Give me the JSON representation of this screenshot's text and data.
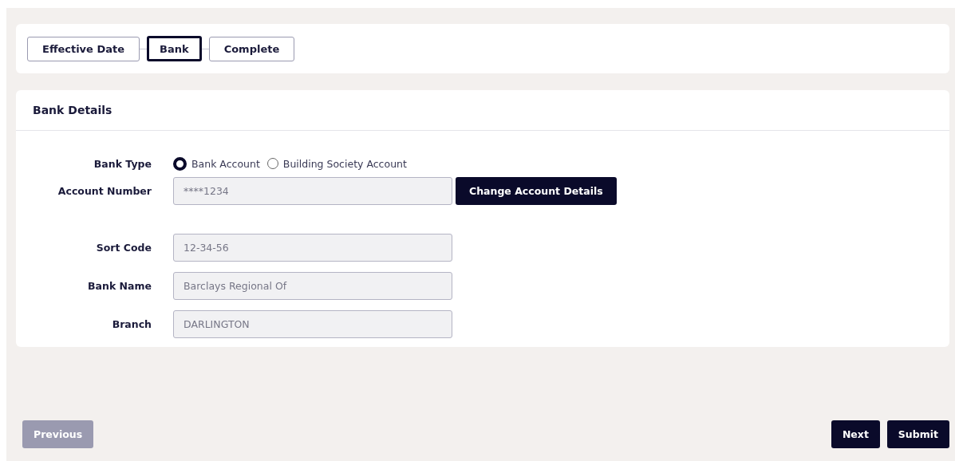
{
  "steps": [
    {
      "label": "Effective Date",
      "selected": false
    },
    {
      "label": "Bank",
      "selected": true
    },
    {
      "label": "Complete",
      "selected": false
    }
  ],
  "section": {
    "title": "Bank Details",
    "bank_type": {
      "label": "Bank Type",
      "options": [
        {
          "label": "Bank Account",
          "selected": true
        },
        {
          "label": "Building Society Account",
          "selected": false
        }
      ]
    },
    "fields": [
      {
        "label": "Account Number",
        "value": "****1234",
        "action": "Change Account Details"
      },
      {
        "label": "Sort Code",
        "value": "12-34-56"
      },
      {
        "label": "Bank Name",
        "value": "Barclays Regional Of"
      },
      {
        "label": "Branch",
        "value": "DARLINGTON"
      }
    ]
  },
  "footer": {
    "left": [
      {
        "label": "Previous",
        "disabled": true
      }
    ],
    "right": [
      {
        "label": "Next",
        "disabled": false
      },
      {
        "label": "Submit",
        "disabled": false
      }
    ]
  }
}
